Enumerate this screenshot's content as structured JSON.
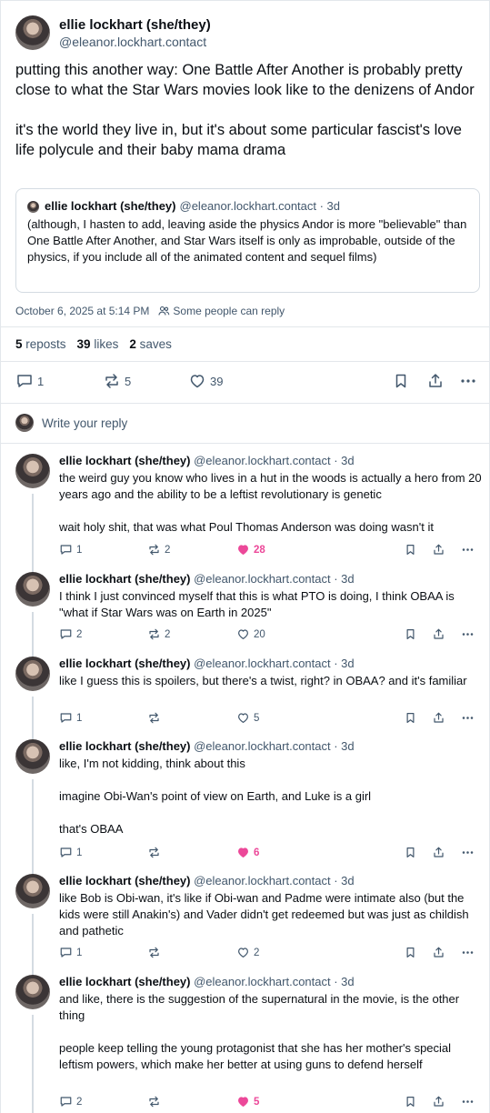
{
  "main_post": {
    "author_name": "ellie lockhart (she/they)",
    "author_handle": "@eleanor.lockhart.contact",
    "text": "putting this another way: One Battle After Another is probably pretty close to what the Star Wars movies look like to the denizens of Andor\n\nit's the world they live in, but it's about some particular fascist's love life polycule and their baby mama drama",
    "quote": {
      "author_name": "ellie lockhart (she/they)",
      "author_handle": "@eleanor.lockhart.contact · 3d",
      "text": "(although, I hasten to add, leaving aside the physics Andor is more \"believable\" than One Battle After Another, and Star Wars itself is only as improbable, outside of the physics, if you include all of the animated content and sequel films)"
    },
    "timestamp": "October 6, 2025 at 5:14 PM",
    "reply_setting": "Some people can reply",
    "stats": {
      "reposts_count": "5",
      "reposts_label": " reposts",
      "likes_count": "39",
      "likes_label": " likes",
      "saves_count": "2",
      "saves_label": " saves"
    },
    "actions": {
      "reply_count": "1",
      "repost_count": "5",
      "like_count": "39"
    }
  },
  "reply_prompt": "Write your reply",
  "replies": [
    {
      "author_name": "ellie lockhart (she/they)",
      "author_handle": " @eleanor.lockhart.contact · 3d",
      "text": "the weird guy you know who lives in a hut in the woods is actually a hero from 20 years ago and the ability to be a leftist revolutionary is genetic\n\nwait holy shit, that was what Poul Thomas Anderson was doing wasn't it",
      "reply_count": "1",
      "repost_count": "2",
      "like_count": "28",
      "liked": true
    },
    {
      "author_name": "ellie lockhart (she/they)",
      "author_handle": " @eleanor.lockhart.contact · 3d",
      "text": "I think I just convinced myself that this is what PTO is doing, I think OBAA is \"what if Star Wars was on Earth in 2025\"",
      "reply_count": "2",
      "repost_count": "2",
      "like_count": "20",
      "liked": false
    },
    {
      "author_name": "ellie lockhart (she/they)",
      "author_handle": " @eleanor.lockhart.contact · 3d",
      "text": "like I guess this is spoilers, but there's a twist, right? in OBAA? and it's familiar",
      "reply_count": "1",
      "repost_count": "",
      "like_count": "5",
      "liked": false
    },
    {
      "author_name": "ellie lockhart (she/they)",
      "author_handle": " @eleanor.lockhart.contact · 3d",
      "text": "like, I'm not kidding, think about this\n\nimagine Obi-Wan's point of view on Earth, and Luke is a girl\n\nthat's OBAA",
      "reply_count": "1",
      "repost_count": "",
      "like_count": "6",
      "liked": true
    },
    {
      "author_name": "ellie lockhart (she/they)",
      "author_handle": " @eleanor.lockhart.contact · 3d",
      "text": "like Bob is Obi-wan, it's like if Obi-wan and Padme were intimate also (but the kids were still Anakin's) and Vader didn't get redeemed but was just as childish and pathetic",
      "reply_count": "1",
      "repost_count": "",
      "like_count": "2",
      "liked": false
    },
    {
      "author_name": "ellie lockhart (she/they)",
      "author_handle": " @eleanor.lockhart.contact · 3d",
      "text": "and like, there is the suggestion of the supernatural in the movie, is the other thing\n\npeople keep telling the young protagonist that she has her mother's special leftism powers, which make her better at using guns to defend herself",
      "reply_count": "2",
      "repost_count": "",
      "like_count": "5",
      "liked": true
    }
  ],
  "colors": {
    "accent_like": "#ec4899",
    "muted": "#42576c",
    "border": "#e3e7eb",
    "text": "#0b0f14"
  },
  "icons": [
    "comment-icon",
    "repost-icon",
    "heart-icon",
    "bookmark-icon",
    "share-icon",
    "more-icon",
    "people-icon"
  ]
}
